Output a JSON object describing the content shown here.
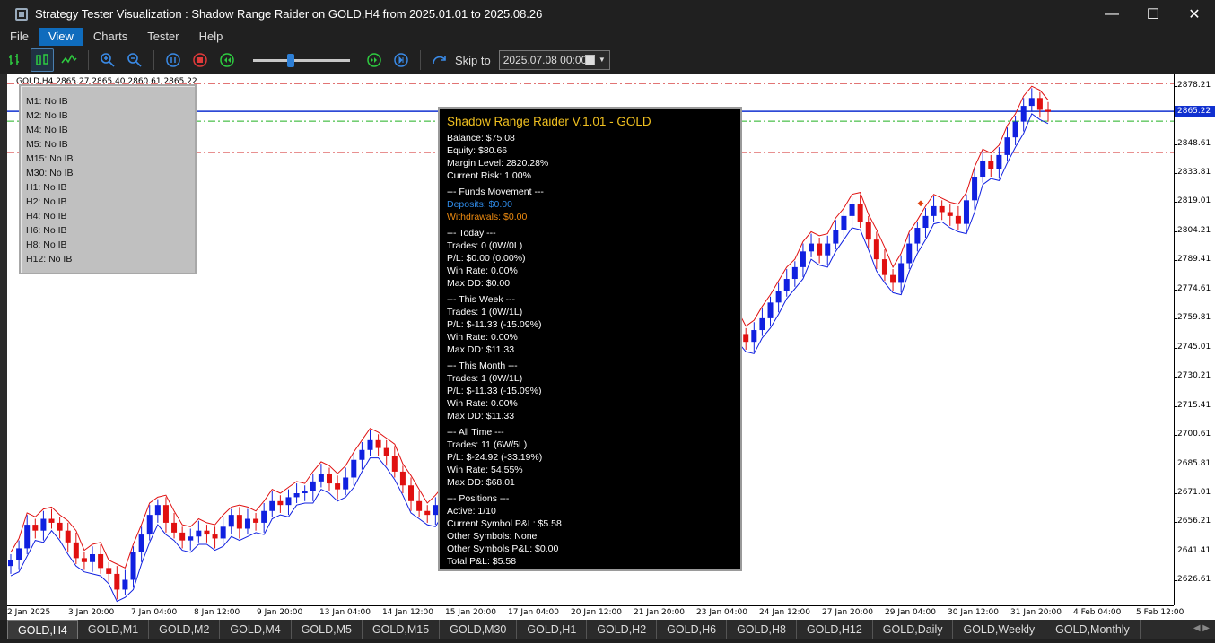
{
  "window": {
    "title": "Strategy Tester Visualization : Shadow Range Raider on GOLD,H4 from 2025.01.01 to 2025.08.26",
    "minimize": "—",
    "maximize": "☐",
    "close": "✕"
  },
  "menu": [
    "File",
    "View",
    "Charts",
    "Tester",
    "Help"
  ],
  "toolbar": {
    "skip_label": "Skip to",
    "skip_date": "2025.07.08 00:00",
    "speed": 0.38
  },
  "chart": {
    "symbol_line": "GOLD,H4  2865.27 2865.40 2860.61 2865.22",
    "current_price": "2865.22",
    "price_labels": [
      "2878.21",
      "2865.22",
      "2848.61",
      "2833.81",
      "2819.01",
      "2804.21",
      "2789.41",
      "2774.61",
      "2759.81",
      "2745.01",
      "2730.21",
      "2715.41",
      "2700.61",
      "2685.81",
      "2671.01",
      "2656.21",
      "2641.41",
      "2626.61"
    ],
    "time_labels": [
      "2 Jan 2025",
      "3 Jan 20:00",
      "7 Jan 04:00",
      "8 Jan 12:00",
      "9 Jan 20:00",
      "13 Jan 04:00",
      "14 Jan 12:00",
      "15 Jan 20:00",
      "17 Jan 04:00",
      "20 Jan 12:00",
      "21 Jan 20:00",
      "23 Jan 04:00",
      "24 Jan 12:00",
      "27 Jan 20:00",
      "29 Jan 04:00",
      "30 Jan 12:00",
      "31 Jan 20:00",
      "4 Feb 04:00",
      "5 Feb 12:00"
    ],
    "colors": {
      "bull": "#1020e0",
      "bear": "#e01010",
      "upper_band": "#e01010",
      "lower_band": "#1020e0",
      "price_line": "#1030d0"
    }
  },
  "chart_data": {
    "type": "candlestick",
    "symbol": "GOLD",
    "timeframe": "H4",
    "ylim": [
      2614,
      2884
    ],
    "levels": {
      "red_dashdot": [
        2879.4,
        2844.3
      ],
      "green_dashdot": [
        2860.2
      ],
      "current_price": 2865.22
    },
    "close": [
      2637,
      2643,
      2655,
      2652,
      2658,
      2656,
      2652,
      2646,
      2638,
      2636,
      2640,
      2633,
      2630,
      2622,
      2627,
      2641,
      2650,
      2660,
      2665,
      2656,
      2651,
      2647,
      2649,
      2652,
      2650,
      2648,
      2654,
      2660,
      2653,
      2658,
      2656,
      2662,
      2667,
      2665,
      2669,
      2671,
      2672,
      2677,
      2681,
      2676,
      2673,
      2679,
      2688,
      2693,
      2698,
      2694,
      2690,
      2682,
      2675,
      2667,
      2662,
      2660,
      2665,
      2669,
      2666,
      2671,
      2670,
      2675,
      2678,
      2673,
      2676,
      2672,
      2680,
      2687,
      2692,
      2696,
      2700,
      2698,
      2701,
      2706,
      2711,
      2712
    ],
    "markers": [
      {
        "type": "sell",
        "price": 2733.5
      },
      {
        "type": "buy",
        "price": 2716.2
      },
      {
        "type": "buy",
        "price": 2774.3
      },
      {
        "type": "sell",
        "price": 2751.9
      },
      {
        "type": "sell",
        "price": 2818.4
      }
    ]
  },
  "ib_panel": [
    "M1: No IB",
    "M2: No IB",
    "M4: No IB",
    "M5: No IB",
    "M15: No IB",
    "M30: No IB",
    "H1: No IB",
    "H2: No IB",
    "H4: No IB",
    "H6: No IB",
    "H8: No IB",
    "H12: No IB"
  ],
  "stats": {
    "title": "Shadow Range Raider V.1.01 - GOLD",
    "balance": "Balance: $75.08",
    "equity": "Equity: $80.66",
    "margin": "Margin Level: 2820.28%",
    "risk": "Current Risk: 1.00%",
    "funds_header": "--- Funds Movement ---",
    "deposits": "Deposits: $0.00",
    "withdrawals": "Withdrawals: $0.00",
    "today_header": "--- Today ---",
    "today_trades": "Trades: 0 (0W/0L)",
    "today_pl": "P/L: $0.00 (0.00%)",
    "today_win": "Win Rate: 0.00%",
    "today_dd": "Max DD: $0.00",
    "week_header": "--- This Week ---",
    "week_trades": "Trades: 1 (0W/1L)",
    "week_pl": "P/L: $-11.33 (-15.09%)",
    "week_win": "Win Rate: 0.00%",
    "week_dd": "Max DD: $11.33",
    "month_header": "--- This Month ---",
    "month_trades": "Trades: 1 (0W/1L)",
    "month_pl": "P/L: $-11.33 (-15.09%)",
    "month_win": "Win Rate: 0.00%",
    "month_dd": "Max DD: $11.33",
    "all_header": "--- All Time ---",
    "all_trades": "Trades: 11 (6W/5L)",
    "all_pl": "P/L: $-24.92 (-33.19%)",
    "all_win": "Win Rate: 54.55%",
    "all_dd": "Max DD: $68.01",
    "pos_header": "--- Positions ---",
    "pos_active": "Active: 1/10",
    "pos_current": "Current Symbol P&L: $5.58",
    "pos_other": "Other Symbols: None",
    "pos_other_pl": "Other Symbols P&L: $0.00",
    "pos_total": "Total P&L: $5.58"
  },
  "tabs": [
    "GOLD,H4",
    "GOLD,M1",
    "GOLD,M2",
    "GOLD,M4",
    "GOLD,M5",
    "GOLD,M15",
    "GOLD,M30",
    "GOLD,H1",
    "GOLD,H2",
    "GOLD,H6",
    "GOLD,H8",
    "GOLD,H12",
    "GOLD,Daily",
    "GOLD,Weekly",
    "GOLD,Monthly"
  ]
}
